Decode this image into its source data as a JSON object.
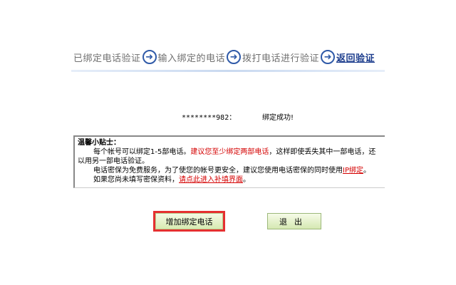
{
  "steps": [
    {
      "label": "已绑定电话验证"
    },
    {
      "label": "输入绑定的电话"
    },
    {
      "label": "拨打电话进行验证"
    },
    {
      "label": "返回验证"
    }
  ],
  "result": {
    "phone": "********982：",
    "message": "绑定成功!"
  },
  "tips": {
    "title": "温馨小贴士：",
    "line1_a": "每个帐号可以绑定1-5部电话。",
    "line1_red": "建议您至少绑定两部电话",
    "line1_b": "，这样即使丢失其中一部电话，还",
    "line2": "以用另一部电话验证。",
    "line3_a": "电话密保为免费服务，为了使您的帐号更安全，建议您使用电话密保的同时使用",
    "line3_link": "IP绑定",
    "line3_b": "。",
    "line4_a": "如果您尚未填写密保资料，",
    "line4_link": "请点此进入补填界面",
    "line4_b": "。"
  },
  "buttons": {
    "add_label": "增加绑定电话",
    "exit_label": "退出"
  },
  "icons": {
    "step_arrow": "arrow-right-circle-icon"
  },
  "colors": {
    "highlight_border": "#e53030",
    "button_bg": "#e8f3cf",
    "link_red": "#d40000",
    "step_current": "#1a3b8c"
  }
}
